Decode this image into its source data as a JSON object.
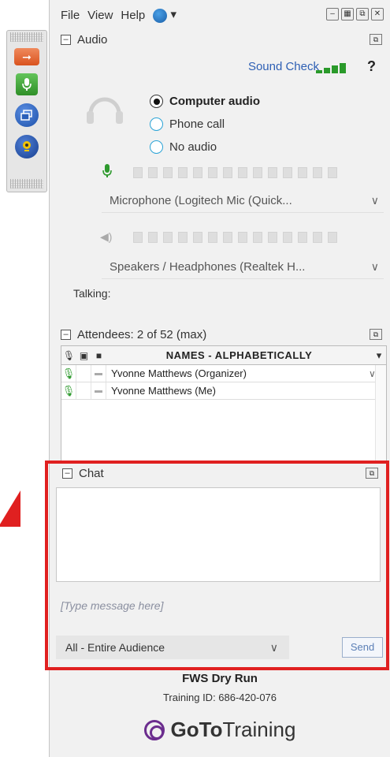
{
  "menu": {
    "file": "File",
    "view": "View",
    "help": "Help"
  },
  "audio": {
    "title": "Audio",
    "sound_check": "Sound Check",
    "help_icon": "?",
    "options": [
      {
        "label": "Computer audio",
        "selected": true
      },
      {
        "label": "Phone call",
        "selected": false
      },
      {
        "label": "No audio",
        "selected": false
      }
    ],
    "microphone": "Microphone (Logitech Mic (Quick...",
    "speakers": "Speakers / Headphones (Realtek H...",
    "talking_label": "Talking:"
  },
  "attendees": {
    "title": "Attendees:  2 of 52 (max)",
    "column_names": "NAMES - ALPHABETICALLY",
    "rows": [
      {
        "name": "Yvonne Matthews (Organizer)"
      },
      {
        "name": "Yvonne Matthews (Me)"
      }
    ]
  },
  "chat": {
    "title": "Chat",
    "placeholder": "[Type message here]",
    "audience": "All - Entire Audience",
    "send": "Send"
  },
  "footer": {
    "session_title": "FWS Dry Run",
    "training_id": "Training ID: 686-420-076",
    "brand_goto": "GoTo",
    "brand_training": "Training"
  },
  "colors": {
    "highlight": "#e02020",
    "link": "#2d5fb4",
    "green": "#2e9a2e",
    "brand_purple": "#6b2d8e"
  }
}
